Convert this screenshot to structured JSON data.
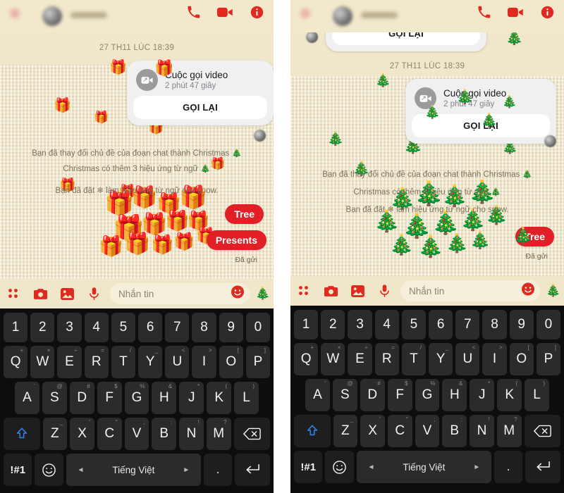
{
  "meta": {
    "app": "Messenger chat - Christmas theme",
    "panels": [
      "left",
      "right"
    ]
  },
  "header": {
    "call_icon": "phone-icon",
    "video_icon": "video-camera-icon",
    "info_icon": "info-icon",
    "contact_name_blurred": "",
    "accent_color": "#e02a20"
  },
  "chat": {
    "datestamp": "27 TH11 LÚC 18:39",
    "call_card": {
      "title": "Cuộc gọi video",
      "duration": "2 phút 47 giây",
      "action_label": "GỌI LẠI",
      "icon": "video-call-icon"
    },
    "system_messages": [
      "Bạn đã thay đổi chủ đề của đoạn chat thành Christmas 🎄",
      "Christmas có thêm 3 hiệu ứng từ ngữ 🎄",
      "Bạn đã đặt ❄ làm hiệu ứng từ ngữ cho snow."
    ],
    "word_effect_bubbles_left": [
      "Tree",
      "Presents"
    ],
    "word_effect_bubbles_right": [
      "Tree"
    ],
    "sent_status": "Đã gửi"
  },
  "composer": {
    "placeholder": "Nhắn tin",
    "icons": [
      "apps-grid-icon",
      "camera-icon",
      "gallery-icon",
      "microphone-icon"
    ],
    "emoji_button": "smiley-icon",
    "sticker_button": "christmas-tree-icon"
  },
  "keyboard": {
    "row_numbers": [
      "1",
      "2",
      "3",
      "4",
      "5",
      "6",
      "7",
      "8",
      "9",
      "0"
    ],
    "row_q": [
      {
        "main": "Q",
        "sup": "+"
      },
      {
        "main": "W",
        "sup": "×"
      },
      {
        "main": "E",
        "sup": "÷"
      },
      {
        "main": "R",
        "sup": "="
      },
      {
        "main": "T",
        "sup": "/"
      },
      {
        "main": "Y",
        "sup": "_"
      },
      {
        "main": "U",
        "sup": "<"
      },
      {
        "main": "I",
        "sup": ">"
      },
      {
        "main": "O",
        "sup": "["
      },
      {
        "main": "P",
        "sup": "]"
      }
    ],
    "row_a": [
      {
        "main": "A",
        "sup": "'"
      },
      {
        "main": "S",
        "sup": "@"
      },
      {
        "main": "D",
        "sup": "#"
      },
      {
        "main": "F",
        "sup": "$"
      },
      {
        "main": "G",
        "sup": "%"
      },
      {
        "main": "H",
        "sup": "&"
      },
      {
        "main": "J",
        "sup": "*"
      },
      {
        "main": "K",
        "sup": "("
      },
      {
        "main": "L",
        "sup": ")"
      }
    ],
    "row_z": [
      {
        "main": "Z",
        "sup": "_"
      },
      {
        "main": "X",
        "sup": "'"
      },
      {
        "main": "C",
        "sup": "\""
      },
      {
        "main": "V",
        "sup": ";"
      },
      {
        "main": "B",
        "sup": ":"
      },
      {
        "main": "N",
        "sup": "!"
      },
      {
        "main": "M",
        "sup": "?"
      }
    ],
    "shift_label": "shift-arrow-icon",
    "backspace_label": "backspace-icon",
    "symbols_label": "!#1",
    "emoji_label": "smiley-icon",
    "space_language": "Tiếng Việt",
    "space_prev": "◄",
    "space_next": "►",
    "period_label": ".",
    "enter_label": "enter-icon"
  }
}
